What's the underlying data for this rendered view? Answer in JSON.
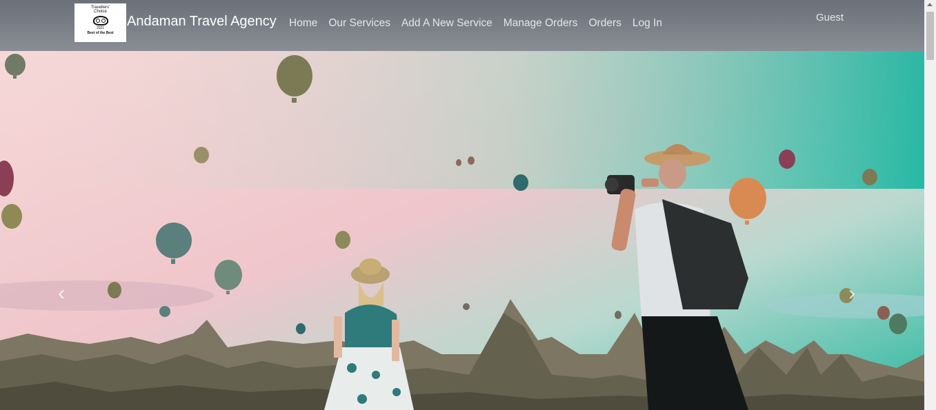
{
  "brand": {
    "logo_lines": [
      "Travellers'",
      "Choice",
      "2021",
      "Best of the Best"
    ],
    "name": "Andaman Travel Agency"
  },
  "nav": {
    "items": [
      "Home",
      "Our Services",
      "Add A New Service",
      "Manage Orders",
      "Orders",
      "Log In"
    ]
  },
  "user": {
    "label": "Guest"
  },
  "hero": {
    "icons": {
      "prev": "chevron-left-icon",
      "next": "chevron-right-icon"
    },
    "colors": {
      "sky_top": "#17b5a0",
      "sky_bottom": "#f4c9cf",
      "rocks": "#6f6e60"
    }
  }
}
